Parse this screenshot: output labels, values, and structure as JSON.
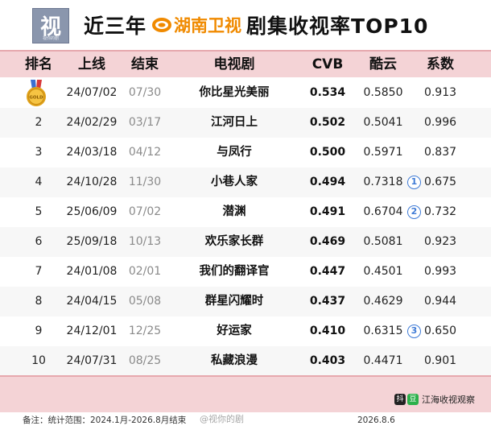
{
  "header": {
    "logo_char": "视",
    "logo_sub": "视你的剧",
    "title_prefix": "近三年",
    "channel_name": "湖南卫视",
    "title_suffix": "剧集收视率TOP10",
    "channel_color": "#f08a00"
  },
  "table": {
    "columns": [
      "排名",
      "上线",
      "结束",
      "电视剧",
      "CVB",
      "酷云",
      "系数"
    ],
    "medal_label": "GOLD",
    "rows": [
      {
        "rank": "1",
        "start": "24/07/02",
        "end": "07/30",
        "title": "你比星光美丽",
        "cvb": "0.534",
        "kuyun": "0.5850",
        "coef": "0.913",
        "mark": ""
      },
      {
        "rank": "2",
        "start": "24/02/29",
        "end": "03/17",
        "title": "江河日上",
        "cvb": "0.502",
        "kuyun": "0.5041",
        "coef": "0.996",
        "mark": ""
      },
      {
        "rank": "3",
        "start": "24/03/18",
        "end": "04/12",
        "title": "与凤行",
        "cvb": "0.500",
        "kuyun": "0.5971",
        "coef": "0.837",
        "mark": ""
      },
      {
        "rank": "4",
        "start": "24/10/28",
        "end": "11/30",
        "title": "小巷人家",
        "cvb": "0.494",
        "kuyun": "0.7318",
        "coef": "0.675",
        "mark": "1"
      },
      {
        "rank": "5",
        "start": "25/06/09",
        "end": "07/02",
        "title": "潜渊",
        "cvb": "0.491",
        "kuyun": "0.6704",
        "coef": "0.732",
        "mark": "2"
      },
      {
        "rank": "6",
        "start": "25/09/18",
        "end": "10/13",
        "title": "欢乐家长群",
        "cvb": "0.469",
        "kuyun": "0.5081",
        "coef": "0.923",
        "mark": ""
      },
      {
        "rank": "7",
        "start": "24/01/08",
        "end": "02/01",
        "title": "我们的翻译官",
        "cvb": "0.447",
        "kuyun": "0.4501",
        "coef": "0.993",
        "mark": ""
      },
      {
        "rank": "8",
        "start": "24/04/15",
        "end": "05/08",
        "title": "群星闪耀时",
        "cvb": "0.437",
        "kuyun": "0.4629",
        "coef": "0.944",
        "mark": ""
      },
      {
        "rank": "9",
        "start": "24/12/01",
        "end": "12/25",
        "title": "好运家",
        "cvb": "0.410",
        "kuyun": "0.6315",
        "coef": "0.650",
        "mark": "3"
      },
      {
        "rank": "10",
        "start": "24/07/31",
        "end": "08/25",
        "title": "私藏浪漫",
        "cvb": "0.403",
        "kuyun": "0.4471",
        "coef": "0.901",
        "mark": ""
      }
    ]
  },
  "footer": {
    "brand_icon_1": "抖",
    "brand_icon_2": "豆",
    "brand_text": "江海收视观察",
    "note": "备注：统计范围：2024.1月-2026.8月结束",
    "watermark": "@视你的剧",
    "date": "2026.8.6"
  },
  "colors": {
    "header_band": "#f4d3d6",
    "accent_line": "#e6a8ae",
    "mark_blue": "#3f7bd6",
    "medal_gold": "#e0a21a"
  },
  "icons": {
    "medal": "gold-medal-icon",
    "mango": "mango-tv-logo-icon",
    "circled_numbers": "circled-number-icon"
  }
}
